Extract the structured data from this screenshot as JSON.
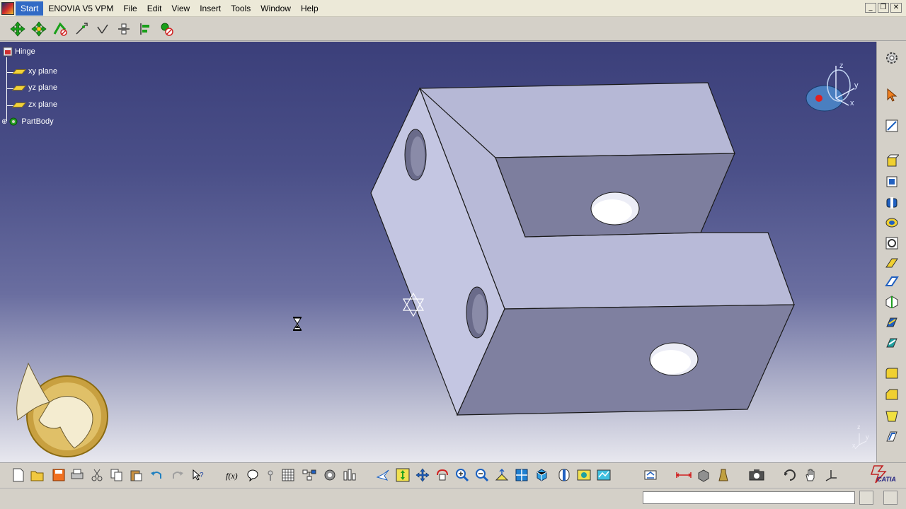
{
  "menu": {
    "items": [
      "Start",
      "ENOVIA V5 VPM",
      "File",
      "Edit",
      "View",
      "Insert",
      "Tools",
      "Window",
      "Help"
    ],
    "active": "Start"
  },
  "window_controls": {
    "minimize": "_",
    "restore": "❐",
    "close": "✕"
  },
  "tree": {
    "root": "Hinge",
    "children": [
      "xy plane",
      "yz plane",
      "zx plane",
      "PartBody"
    ]
  },
  "compass": {
    "z_label": "z",
    "y_label": "y",
    "x_label": "x"
  },
  "mini_axis": {
    "z_label": "z",
    "y_label": "y",
    "x_label": "x"
  },
  "brand": {
    "logo_text": "CATIA",
    "watermark": "pegasus-logo"
  },
  "status": {
    "command_value": ""
  },
  "colors": {
    "viewport_top": "#3b3f7a",
    "viewport_bottom": "#e8e8ef",
    "part_face": "#b5b7d8",
    "part_shadow": "#7f80a0",
    "menu_active": "#316ac5",
    "tree_text": "#ffffff",
    "plane_icon": "#f2d23a"
  },
  "icons": {
    "top_toolbar": [
      "move-icon",
      "rotate-icon",
      "snap-icon",
      "axis-icon",
      "line-icon",
      "spacing-icon",
      "align-icon",
      "remove-icon"
    ],
    "right_toolbar": [
      "gear-icon",
      "select-arrow-icon",
      "sketch-icon",
      "pad-icon",
      "pocket-icon",
      "shaft-icon",
      "groove-icon",
      "hole-icon",
      "rib-icon",
      "slot-icon",
      "stiffener-icon",
      "loft-icon",
      "remove-loft-icon",
      "fillet-icon",
      "chamfer-icon",
      "draft-icon",
      "shell-icon"
    ],
    "bottom_toolbar": [
      "new-icon",
      "open-icon",
      "save-icon",
      "print-icon",
      "cut-icon",
      "copy-icon",
      "paste-icon",
      "undo-icon",
      "redo-icon",
      "whats-this-icon",
      "formula-icon",
      "knowledge-icon",
      "check-icon",
      "table-icon",
      "graph-icon",
      "catalog-icon",
      "measure-icon",
      "fly-icon",
      "fit-all-icon",
      "pan-icon",
      "rotate-view-icon",
      "zoom-in-icon",
      "zoom-out-icon",
      "normal-view-icon",
      "multi-view-icon",
      "iso-view-icon",
      "shading-icon",
      "hide-show-icon",
      "swap-visible-icon",
      "update-icon",
      "measure-between-icon",
      "measure-item-icon",
      "mass-icon",
      "capture-icon",
      "refresh-icon",
      "hand-icon",
      "axis-system-icon"
    ]
  }
}
